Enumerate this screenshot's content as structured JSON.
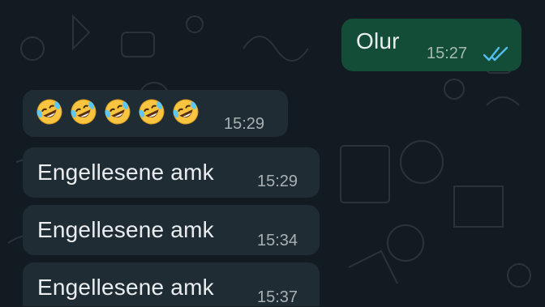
{
  "colors": {
    "background": "#121b22",
    "outgoing_bubble": "#144d37",
    "incoming_bubble": "#1f2c33",
    "text": "#e9edef",
    "read_ticks": "#53bdeb"
  },
  "messages": {
    "m1": {
      "direction": "outgoing",
      "text": "Olur",
      "time": "15:27",
      "status": "read",
      "status_icon": "double-check-icon"
    },
    "m2": {
      "direction": "incoming",
      "emoji_icon": "rolling-on-the-floor-laughing-emoji",
      "emoji_count": 5,
      "time": "15:29"
    },
    "m3": {
      "direction": "incoming",
      "text": "Engellesene amk",
      "time": "15:29"
    },
    "m4": {
      "direction": "incoming",
      "text": "Engellesene amk",
      "time": "15:34"
    },
    "m5": {
      "direction": "incoming",
      "text": "Engellesene amk",
      "time": "15:37"
    }
  }
}
